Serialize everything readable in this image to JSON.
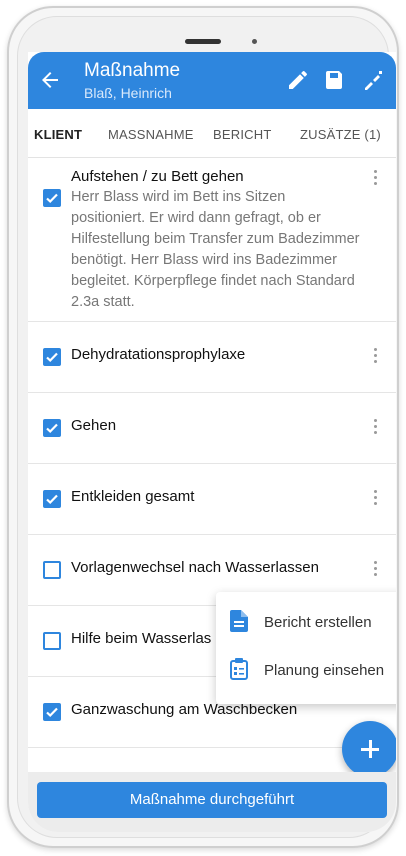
{
  "colors": {
    "accent": "#2e86de",
    "text_primary": "#111111",
    "text_secondary": "#777777"
  },
  "appbar": {
    "title": "Maßnahme",
    "subtitle": "Blaß, Heinrich",
    "icons": [
      "back-arrow-icon",
      "edit-pencil-icon",
      "save-icon",
      "sign-icon"
    ]
  },
  "tabs": [
    {
      "label": "KLIENT",
      "active": true
    },
    {
      "label": "MASSNAHME",
      "active": false
    },
    {
      "label": "BERICHT",
      "active": false
    },
    {
      "label": "ZUSÄTZE (1)",
      "active": false
    }
  ],
  "items": [
    {
      "title": "Aufstehen / zu Bett gehen",
      "description": "Herr Blass wird im Bett ins Sitzen positioniert. Er wird dann gefragt, ob er Hilfestellung beim Transfer zum Badezimmer benötigt. Herr Blass wird ins Badezimmer begleitet. Körperpflege findet nach Standard 2.3a statt.",
      "checked": true
    },
    {
      "title": "Dehydratationsprophylaxe",
      "checked": true
    },
    {
      "title": "Gehen",
      "checked": true
    },
    {
      "title": "Entkleiden gesamt",
      "checked": true
    },
    {
      "title": "Vorlagenwechsel nach Wasserlassen",
      "checked": false
    },
    {
      "title": "Hilfe beim Wasserlas",
      "checked": false
    },
    {
      "title": "Ganzwaschung am Waschbecken",
      "checked": true
    }
  ],
  "popup_menu": {
    "items": [
      {
        "label": "Bericht erstellen",
        "icon": "document-icon"
      },
      {
        "label": "Planung einsehen",
        "icon": "clipboard-icon"
      }
    ]
  },
  "fab": {
    "icon": "plus-icon"
  },
  "primary_action": {
    "label": "Maßnahme durchgeführt"
  }
}
